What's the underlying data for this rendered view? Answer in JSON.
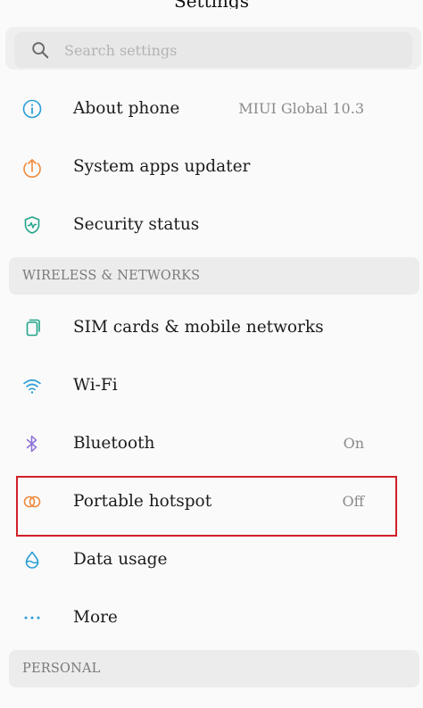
{
  "header": {
    "title": "Settings"
  },
  "search": {
    "placeholder": "Search settings",
    "icon": "search-icon"
  },
  "items_top": [
    {
      "label": "About phone",
      "value": "MIUI Global 10.3",
      "icon": "info-icon",
      "color": "#2a9fd6"
    },
    {
      "label": "System apps updater",
      "value": "",
      "icon": "update-arrow-icon",
      "color": "#ef8a3e"
    },
    {
      "label": "Security status",
      "value": "",
      "icon": "shield-icon",
      "color": "#22a58a"
    }
  ],
  "sections": {
    "wireless": "WIRELESS & NETWORKS",
    "personal": "PERSONAL"
  },
  "items_wireless": [
    {
      "label": "SIM cards & mobile networks",
      "value": "",
      "icon": "sim-card-icon",
      "color": "#22a58a"
    },
    {
      "label": "Wi-Fi",
      "value": "",
      "icon": "wifi-icon",
      "color": "#2a9fd6"
    },
    {
      "label": "Bluetooth",
      "value": "On",
      "icon": "bluetooth-icon",
      "color": "#8b6fd6"
    },
    {
      "label": "Portable hotspot",
      "value": "Off",
      "icon": "hotspot-icon",
      "color": "#ef8a3e"
    },
    {
      "label": "Data usage",
      "value": "",
      "icon": "water-drop-icon",
      "color": "#2a9fd6"
    },
    {
      "label": "More",
      "value": "",
      "icon": "more-dots-icon",
      "color": "#2a9fd6"
    }
  ],
  "highlight_color": "#d0202a"
}
